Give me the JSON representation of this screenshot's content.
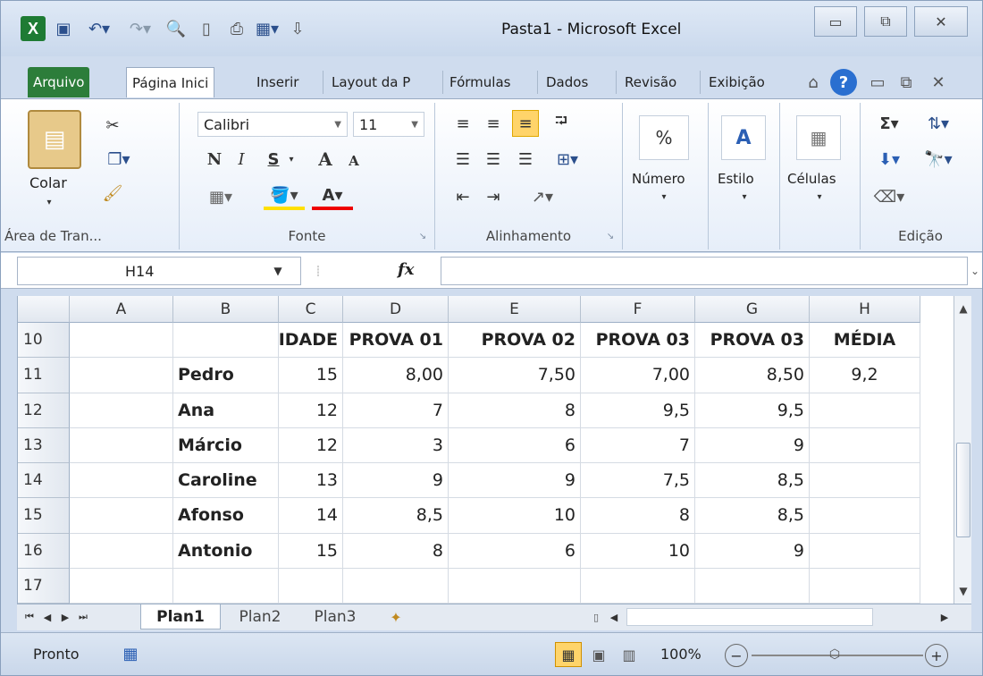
{
  "window": {
    "title": "Pasta1 - Microsoft Excel",
    "min_glyph": "▭",
    "max_glyph": "⧉",
    "close_glyph": "✕"
  },
  "qat": {
    "excel_logo": "X",
    "save_icon": "save-icon",
    "undo_glyph": "↶▾",
    "redo_glyph": "↷▾"
  },
  "ribbon_tabs": [
    "Arquivo",
    "Página Inici",
    "Inserir",
    "Layout da P",
    "Fórmulas",
    "Dados",
    "Revisão",
    "Exibição"
  ],
  "ribbon": {
    "clipboard": {
      "paste": "Colar",
      "label": "Área de Tran..."
    },
    "font": {
      "name": "Calibri",
      "size": "11",
      "bold": "N",
      "italic": "I",
      "strike": "S",
      "grow": "A",
      "shrink": "A",
      "label": "Fonte"
    },
    "alignment": {
      "label": "Alinhamento"
    },
    "number": {
      "symbol": "%",
      "label": "Número"
    },
    "style": {
      "symbol": "A",
      "label": "Estilo"
    },
    "cells": {
      "label": "Células"
    },
    "editing": {
      "sum": "Σ",
      "label": "Edição"
    }
  },
  "formula_bar": {
    "cell_ref": "H14",
    "fx": "fx",
    "content": ""
  },
  "columns": [
    "A",
    "B",
    "C",
    "D",
    "E",
    "F",
    "G",
    "H"
  ],
  "rows": [
    {
      "num": "10",
      "cells": [
        "",
        "",
        "IDADE",
        "PROVA 01",
        "PROVA 02",
        "PROVA 03",
        "PROVA 03",
        "MÉDIA"
      ]
    },
    {
      "num": "11",
      "cells": [
        "",
        "Pedro",
        "15",
        "8,00",
        "7,50",
        "7,00",
        "8,50",
        "9,2"
      ]
    },
    {
      "num": "12",
      "cells": [
        "",
        "Ana",
        "12",
        "7",
        "8",
        "9,5",
        "9,5",
        ""
      ]
    },
    {
      "num": "13",
      "cells": [
        "",
        "Márcio",
        "12",
        "3",
        "6",
        "7",
        "9",
        ""
      ]
    },
    {
      "num": "14",
      "cells": [
        "",
        "Caroline",
        "13",
        "9",
        "9",
        "7,5",
        "8,5",
        ""
      ]
    },
    {
      "num": "15",
      "cells": [
        "",
        "Afonso",
        "14",
        "8,5",
        "10",
        "8",
        "8,5",
        ""
      ]
    },
    {
      "num": "16",
      "cells": [
        "",
        "Antonio",
        "15",
        "8",
        "6",
        "10",
        "9",
        ""
      ]
    },
    {
      "num": "17",
      "cells": [
        "",
        "",
        "",
        "",
        "",
        "",
        "",
        ""
      ]
    }
  ],
  "sheets": [
    "Plan1",
    "Plan2",
    "Plan3"
  ],
  "status": {
    "ready": "Pronto",
    "zoom": "100%"
  },
  "colors": {
    "excel_green": "#1e7b34",
    "file_tab": "#2c7d3a",
    "ribbon_bg": "#dfe9f6"
  }
}
